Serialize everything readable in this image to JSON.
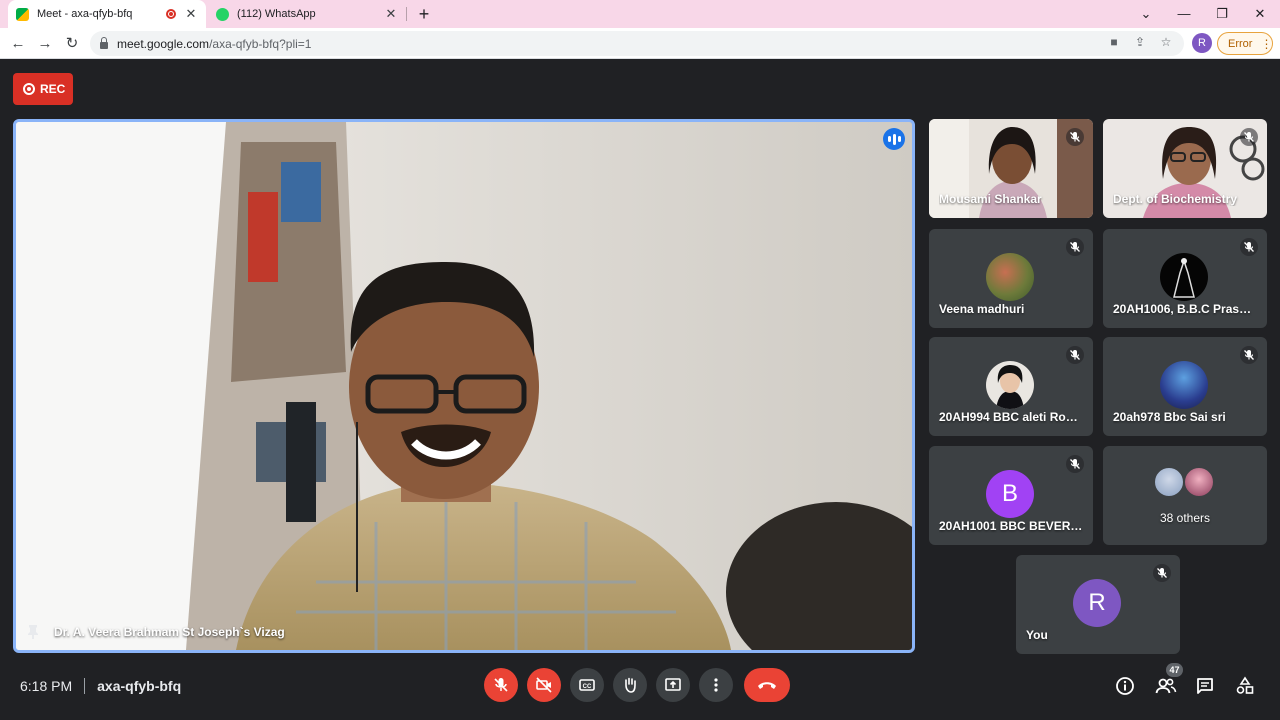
{
  "browser": {
    "tabs": [
      {
        "title": "Meet - axa-qfyb-bfq",
        "active": true
      },
      {
        "title": "(112) WhatsApp",
        "active": false
      }
    ],
    "url_host": "meet.google.com",
    "url_path": "/axa-qfyb-bfq?pli=1",
    "profile_initial": "R",
    "error_label": "Error"
  },
  "meet": {
    "rec_label": "REC",
    "main_speaker": "Dr. A. Veera Brahmam St Joseph`s Vizag",
    "participants": [
      {
        "name": "Mousami Shankar",
        "kind": "video"
      },
      {
        "name": "Dept. of Biochemistry",
        "kind": "video"
      },
      {
        "name": "Veena madhuri",
        "kind": "photo"
      },
      {
        "name": "20AH1006, B.B.C Prasan...",
        "kind": "photo"
      },
      {
        "name": "20AH994 BBC aleti Rosh...",
        "kind": "photo"
      },
      {
        "name": "20ah978 Bbc Sai sri",
        "kind": "photo"
      },
      {
        "name": "20AH1001 BBC BEVERA ...",
        "kind": "letter",
        "initial": "B"
      },
      {
        "name": "38 others",
        "kind": "others"
      }
    ],
    "self": {
      "name": "You",
      "initial": "R"
    },
    "time": "6:18 PM",
    "meeting_code": "axa-qfyb-bfq",
    "participant_count": "47"
  },
  "colors": {
    "accent": "#8ab4f8",
    "danger": "#ea4335",
    "avatar_b": "#a142f4",
    "avatar_r": "#7e57c2"
  }
}
